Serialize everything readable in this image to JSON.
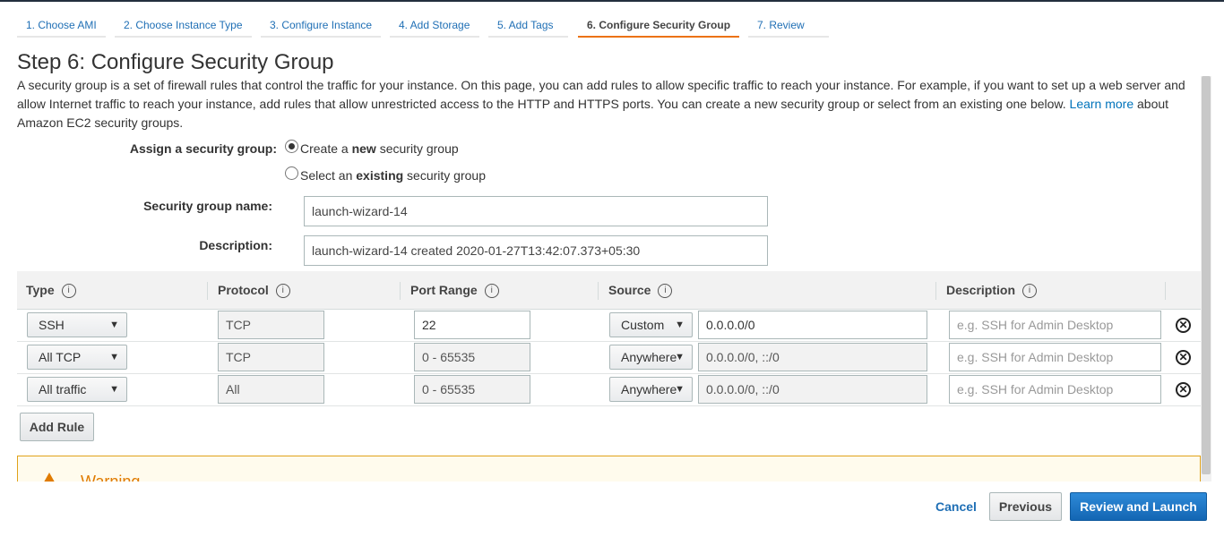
{
  "wizard_tabs": [
    {
      "label": "1. Choose AMI"
    },
    {
      "label": "2. Choose Instance Type"
    },
    {
      "label": "3. Configure Instance"
    },
    {
      "label": "4. Add Storage"
    },
    {
      "label": "5. Add Tags"
    },
    {
      "label": "6. Configure Security Group",
      "active": true
    },
    {
      "label": "7. Review"
    }
  ],
  "page_title": "Step 6: Configure Security Group",
  "intro": {
    "text": "A security group is a set of firewall rules that control the traffic for your instance. On this page, you can add rules to allow specific traffic to reach your instance. For example, if you want to set up a web server and allow Internet traffic to reach your instance, add rules that allow unrestricted access to the HTTP and HTTPS ports. You can create a new security group or select from an existing one below.",
    "link_text": "Learn more",
    "suffix": "about Amazon EC2 security groups."
  },
  "assign": {
    "label": "Assign a security group:",
    "option_create": {
      "prefix": "Create a ",
      "bold": "new",
      "suffix": " security group",
      "checked": true
    },
    "option_existing": {
      "prefix": "Select an ",
      "bold": "existing",
      "suffix": " security group",
      "checked": false
    }
  },
  "group_name": {
    "label": "Security group name:",
    "value": "launch-wizard-14"
  },
  "description": {
    "label": "Description:",
    "value": "launch-wizard-14 created 2020-01-27T13:42:07.373+05:30"
  },
  "table": {
    "headers": {
      "type": "Type",
      "protocol": "Protocol",
      "port_range": "Port Range",
      "source": "Source",
      "description": "Description"
    },
    "info_glyph": "i",
    "rows": [
      {
        "type": "SSH",
        "protocol": "TCP",
        "port_range": "22",
        "source_type": "Custom",
        "source": "0.0.0.0/0",
        "description_placeholder": "e.g. SSH for Admin Desktop"
      },
      {
        "type": "All TCP",
        "protocol": "TCP",
        "port_range": "0 - 65535",
        "source_type": "Anywhere",
        "source": "0.0.0.0/0, ::/0",
        "description_placeholder": "e.g. SSH for Admin Desktop"
      },
      {
        "type": "All traffic",
        "protocol": "All",
        "port_range": "0 - 65535",
        "source_type": "Anywhere",
        "source": "0.0.0.0/0, ::/0",
        "description_placeholder": "e.g. SSH for Admin Desktop"
      }
    ]
  },
  "add_rule_label": "Add Rule",
  "warning": {
    "title": "Warning"
  },
  "footer": {
    "cancel": "Cancel",
    "previous": "Previous",
    "review_launch": "Review and Launch"
  },
  "icons": {
    "chevron": "chevron-down-icon",
    "remove": "remove-circle-icon",
    "info": "info-icon",
    "warning": "warning-triangle-icon"
  },
  "colors": {
    "link": "#1f6fb5",
    "active_tab_underline": "#ec7211",
    "primary_button": "#1a73c2",
    "warning": "#e07b00"
  }
}
